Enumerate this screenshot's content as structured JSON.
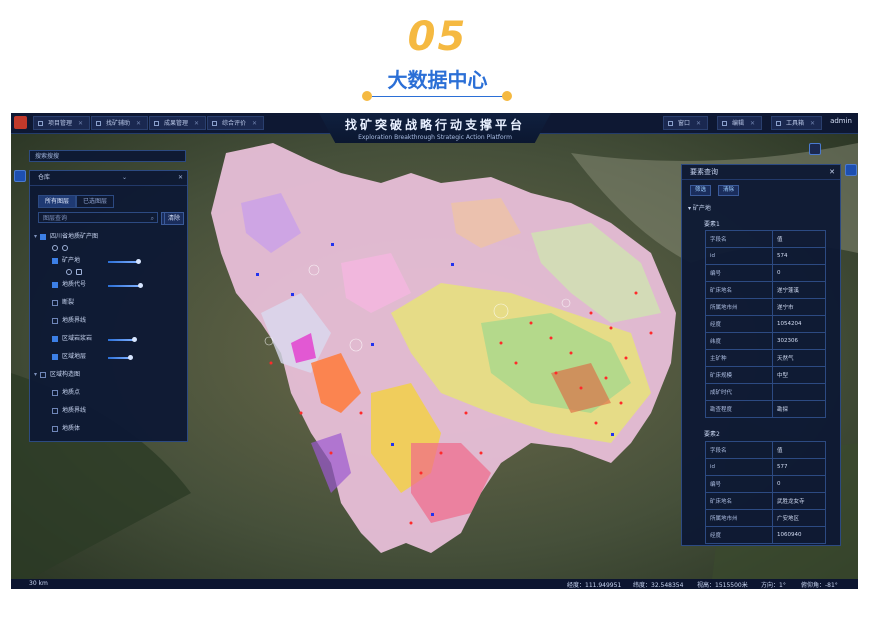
{
  "hero": {
    "number": "05",
    "title": "大数据中心"
  },
  "topbar": {
    "menus": [
      "项目管理",
      "找矿辅助",
      "成果管理",
      "综合评价"
    ],
    "right_menus": [
      "窗口",
      "编辑",
      "工具箱"
    ],
    "title_cn": "找矿突破战略行动支撑平台",
    "title_en": "Exploration Breakthrough Strategic Action Platform",
    "user": "admin",
    "close_mark": "✕"
  },
  "left_panel": {
    "search_label": "搜索搜搜",
    "header": "仓库",
    "tabs": [
      "所有图层",
      "已选图层"
    ],
    "search_placeholder": "图层查询",
    "collapse_btn": "收起",
    "clear_btn": "清除",
    "layers": [
      {
        "label": "四川省地质矿产图",
        "checked": true,
        "level": 0
      },
      {
        "label": "矿产地",
        "checked": true,
        "level": 1
      },
      {
        "label": "地质代号",
        "checked": true,
        "level": 1
      },
      {
        "label": "断裂",
        "checked": false,
        "level": 1
      },
      {
        "label": "地质界线",
        "checked": false,
        "level": 1
      },
      {
        "label": "区域岩浆岩",
        "checked": true,
        "level": 1
      },
      {
        "label": "区域地层",
        "checked": true,
        "level": 1
      },
      {
        "label": "区域构造图",
        "checked": false,
        "level": 0
      },
      {
        "label": "地质点",
        "checked": false,
        "level": 1
      },
      {
        "label": "地质界线",
        "checked": false,
        "level": 1
      },
      {
        "label": "地质体",
        "checked": false,
        "level": 1
      }
    ]
  },
  "right_panel": {
    "title": "要素查询",
    "buttons": [
      "筛选",
      "清除"
    ],
    "group": "矿产地",
    "element1": {
      "title": "要素1",
      "rows": [
        [
          "字段名",
          "值"
        ],
        [
          "id",
          "574"
        ],
        [
          "编号",
          "0"
        ],
        [
          "矿床地名",
          "遂宁蓬溪"
        ],
        [
          "所属地市州",
          "遂宁市"
        ],
        [
          "经度",
          "1054204"
        ],
        [
          "纬度",
          "302306"
        ],
        [
          "主矿种",
          "天然气"
        ],
        [
          "矿床规模",
          "中型"
        ],
        [
          "成矿时代",
          ""
        ],
        [
          "勘查程度",
          "勘探"
        ]
      ]
    },
    "element2": {
      "title": "要素2",
      "rows": [
        [
          "字段名",
          "值"
        ],
        [
          "id",
          "577"
        ],
        [
          "编号",
          "0"
        ],
        [
          "矿床地名",
          "武胜龙女寺"
        ],
        [
          "所属地市州",
          "广安地区"
        ],
        [
          "经度",
          "1060940"
        ]
      ]
    }
  },
  "statusbar": {
    "scale": "30 km",
    "lon": "经度：111.949951",
    "lat": "纬度：32.548354",
    "alt": "视高：1515500米",
    "heading": "方向：1°",
    "pitch": "俯仰角：-81°"
  },
  "colors": {
    "accent": "#2b6fd6",
    "gold": "#f5b941",
    "panel": "#0d1834"
  }
}
